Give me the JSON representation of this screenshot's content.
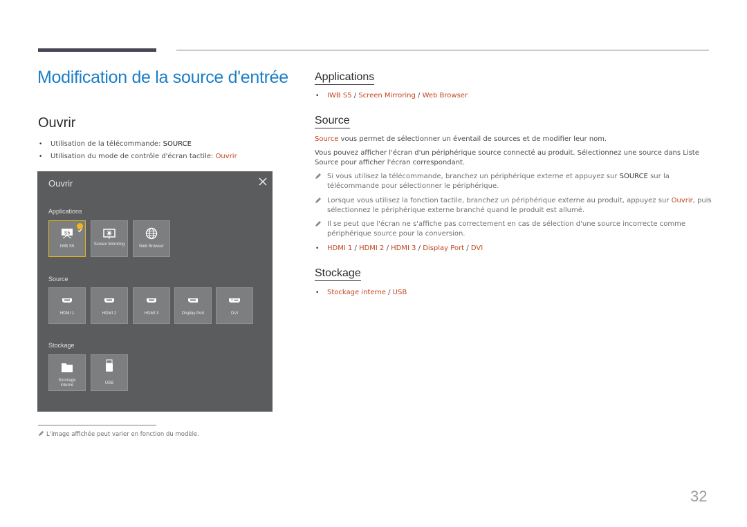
{
  "page": {
    "title": "Modification de la source d'entrée",
    "page_number": "32"
  },
  "left": {
    "section_title": "Ouvrir",
    "bullets": [
      {
        "text": "Utilisation de la télécommande: ",
        "keyword": "SOURCE"
      },
      {
        "text": "Utilisation du mode de contrôle d'écran tactile: ",
        "link": "Ouvrir"
      }
    ]
  },
  "panel": {
    "title": "Ouvrir",
    "close_icon": "close-icon",
    "sections": {
      "applications": {
        "label": "Applications",
        "tiles": [
          {
            "label": "IWB S5",
            "icon": "whiteboard-icon",
            "selected": true
          },
          {
            "label": "Screen Mirroring",
            "icon": "screen-mirroring-icon",
            "selected": false
          },
          {
            "label": "Web Browser",
            "icon": "globe-icon",
            "selected": false
          }
        ]
      },
      "source": {
        "label": "Source",
        "tiles": [
          {
            "label": "HDMI 1",
            "icon": "hdmi-port-icon"
          },
          {
            "label": "HDMI 2",
            "icon": "hdmi-port-icon"
          },
          {
            "label": "HDMI 3",
            "icon": "hdmi-port-icon"
          },
          {
            "label": "Display Port",
            "icon": "displayport-icon"
          },
          {
            "label": "DVI",
            "icon": "dvi-port-icon"
          }
        ]
      },
      "storage": {
        "label": "Stockage",
        "tiles": [
          {
            "label": "Stockage interne",
            "icon": "folder-icon"
          },
          {
            "label": "USB",
            "icon": "usb-drive-icon"
          }
        ]
      }
    },
    "whiteboard_badge": "S5"
  },
  "footnote": "L'image affichée peut varier en fonction du modèle.",
  "right": {
    "applications": {
      "heading": "Applications",
      "links": [
        "IWB S5",
        "Screen Mirroring",
        "Web Browser"
      ]
    },
    "source": {
      "heading": "Source",
      "intro_link": "Source",
      "intro_rest": " vous permet de sélectionner un éventail de sources et de modifier leur nom.",
      "para2": "Vous pouvez afficher l'écran d'un périphérique source connecté au produit. Sélectionnez une source dans Liste Source pour afficher l'écran correspondant.",
      "notes": [
        {
          "before": "Si vous utilisez la télécommande, branchez un périphérique externe et appuyez sur ",
          "kw": "SOURCE",
          "after": " sur la télécommande pour sélectionner le périphérique."
        },
        {
          "before": "Lorsque vous utilisez la fonction tactile, branchez un périphérique externe au produit, appuyez sur ",
          "link": "Ouvrir",
          "after": ", puis sélectionnez le périphérique externe branché quand le produit est allumé."
        },
        {
          "before": "Il se peut que l'écran ne s'affiche pas correctement en cas de sélection d'une source incorrecte comme périphérique source pour la conversion."
        }
      ],
      "links": [
        "HDMI 1",
        "HDMI 2",
        "HDMI 3",
        "Display Port",
        "DVI"
      ]
    },
    "storage": {
      "heading": "Stockage",
      "links": [
        "Stockage interne",
        "USB"
      ]
    },
    "separator": " / "
  },
  "colors": {
    "title_blue": "#1c7ec6",
    "link_red": "#c1461f",
    "panel_bg": "#5b5c5e",
    "tile_bg": "#7d7e80",
    "selected_border": "#e2b423",
    "check_badge": "#efb71c"
  }
}
